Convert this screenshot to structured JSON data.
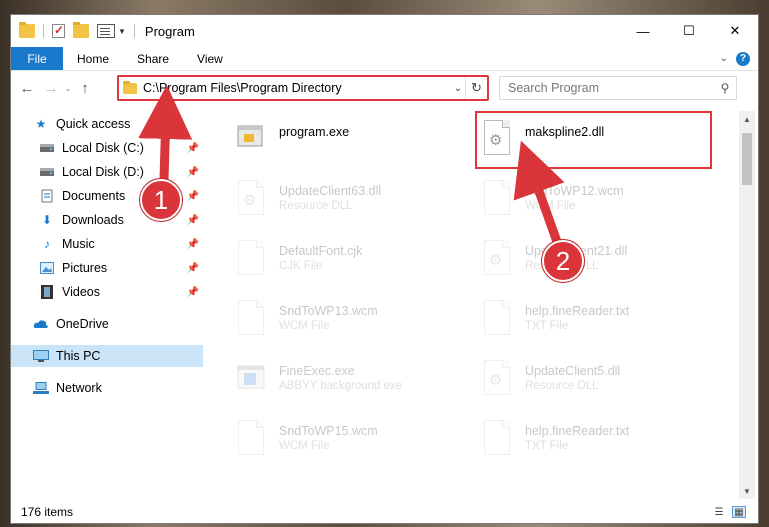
{
  "window": {
    "title": "Program",
    "controls": {
      "minimize": "—",
      "maximize": "☐",
      "close": "✕"
    }
  },
  "ribbon": {
    "tabs": [
      {
        "label": "File"
      },
      {
        "label": "Home"
      },
      {
        "label": "Share"
      },
      {
        "label": "View"
      }
    ],
    "help": "?"
  },
  "navbar": {
    "address": "C:\\Program Files\\Program Directory",
    "search_placeholder": "Search Program"
  },
  "sidebar": {
    "items": [
      {
        "label": "Quick access",
        "icon": "star-icon"
      },
      {
        "label": "Local Disk (C:)",
        "icon": "drive-icon",
        "pinned": true
      },
      {
        "label": "Local Disk (D:)",
        "icon": "drive-icon",
        "pinned": true
      },
      {
        "label": "Documents",
        "icon": "documents-icon",
        "pinned": true
      },
      {
        "label": "Downloads",
        "icon": "downloads-icon",
        "pinned": true
      },
      {
        "label": "Music",
        "icon": "music-icon",
        "pinned": true
      },
      {
        "label": "Pictures",
        "icon": "pictures-icon",
        "pinned": true
      },
      {
        "label": "Videos",
        "icon": "videos-icon",
        "pinned": true
      },
      {
        "label": "OneDrive",
        "icon": "cloud-icon"
      },
      {
        "label": "This PC",
        "icon": "computer-icon",
        "selected": true
      },
      {
        "label": "Network",
        "icon": "network-icon"
      }
    ]
  },
  "files": [
    {
      "name": "program.exe",
      "type": "",
      "icon": "exe-icon"
    },
    {
      "name": "makspline2.dll",
      "type": "",
      "icon": "dll-icon"
    },
    {
      "name": "UpdateClient63.dll",
      "type": "Resource DLL",
      "icon": "dll-icon"
    },
    {
      "name": "SndToWP12.wcm",
      "type": "WCM File",
      "icon": "file-icon"
    },
    {
      "name": "DefaultFont.cjk",
      "type": "CJK File",
      "icon": "file-icon"
    },
    {
      "name": "UpdateClient21.dll",
      "type": "Resource DLL",
      "icon": "dll-icon"
    },
    {
      "name": "SndToWP13.wcm",
      "type": "WCM File",
      "icon": "file-icon"
    },
    {
      "name": "help.fineReader.txt",
      "type": "TXT File",
      "icon": "file-icon"
    },
    {
      "name": "FineExec.exe",
      "type": "ABBYY background exe",
      "icon": "exe-icon"
    },
    {
      "name": "UpdateClient5.dll",
      "type": "Resource DLL",
      "icon": "dll-icon"
    },
    {
      "name": "SndToWP15.wcm",
      "type": "WCM File",
      "icon": "file-icon"
    },
    {
      "name": "help.fineReader.txt",
      "type": "TXT File",
      "icon": "file-icon"
    }
  ],
  "status": {
    "item_count": "176 items"
  },
  "callouts": {
    "one": "1",
    "two": "2"
  },
  "colors": {
    "accent": "#1979ca",
    "highlight": "#e0353a",
    "selected": "#cce4f7"
  }
}
